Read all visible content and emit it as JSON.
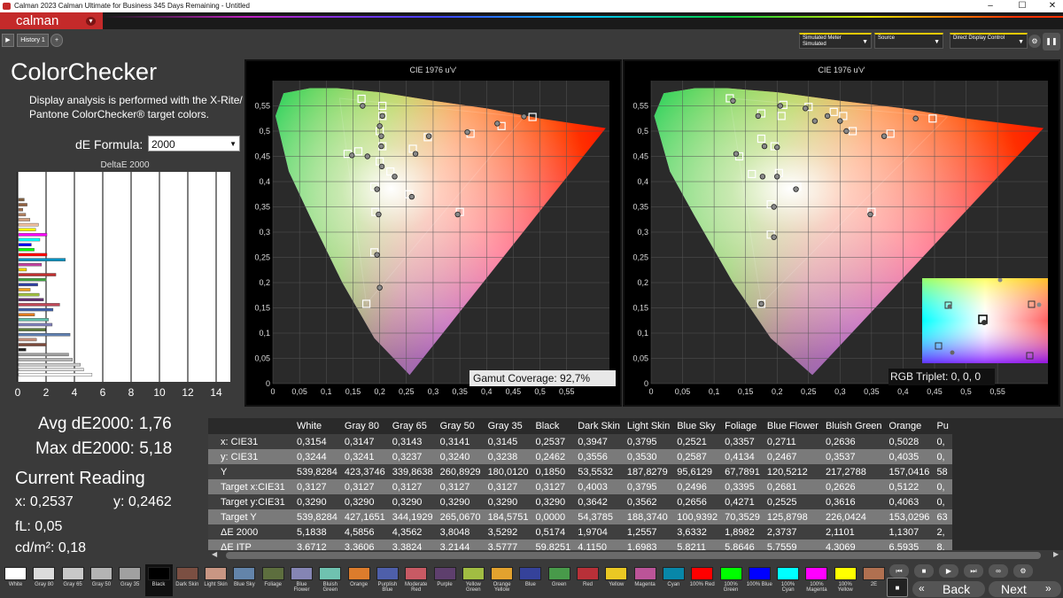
{
  "window": {
    "title": "Calman 2023 Calman Ultimate for Business 345 Days Remaining - Untitled",
    "min": "–",
    "max": "☐",
    "close": "✕"
  },
  "app": {
    "logo": "calman",
    "caret": "▾"
  },
  "tabs": {
    "history": "History 1",
    "add": "+"
  },
  "toolbar": {
    "sim_meter_line1": "Simulated Meter",
    "sim_meter_line2": "Simulated",
    "source": "Source",
    "ddc": "Direct Display Control"
  },
  "left": {
    "title": "ColorChecker",
    "description": "Display analysis is performed with the X-Rite/ Pantone ColorChecker® target colors.",
    "de_formula_label": "dE Formula:",
    "de_formula_value": "2000",
    "chart_title": "DeltaE 2000"
  },
  "stats": {
    "avg": "Avg dE2000: 1,76",
    "max": "Max dE2000: 5,18",
    "current_reading": "Current Reading",
    "x": "x: 0,2537",
    "y": "y: 0,2462",
    "fl": "fL: 0,05",
    "cdm2": "cd/m²: 0,18"
  },
  "plots": {
    "title": "CIE 1976 u'v'",
    "gamut": "Gamut Coverage:  92,7%",
    "rgb": "RGB Triplet: 0, 0, 0"
  },
  "chart_data": [
    {
      "type": "bar",
      "orientation": "horizontal",
      "title": "DeltaE 2000",
      "xlim": [
        0,
        15
      ],
      "xticks": [
        "0",
        "2",
        "4",
        "6",
        "8",
        "10",
        "12",
        "14"
      ],
      "values": [
        5.18,
        4.59,
        4.36,
        3.8,
        3.53,
        0.52,
        1.97,
        1.26,
        3.63,
        1.9,
        2.37,
        2.11,
        1.13,
        2.43,
        2.9,
        1.76,
        1.45,
        0.82,
        1.35,
        1.95,
        2.63,
        0.56,
        1.62,
        3.3,
        2.0,
        1.1,
        0.9,
        1.5,
        2.0,
        1.2,
        1.4,
        0.8,
        0.5,
        0.3,
        0.6,
        0.4
      ],
      "colors": [
        "#ffffff",
        "#e0e0e0",
        "#cccccc",
        "#b5b5b5",
        "#9d9d9d",
        "#222222",
        "#7b4a3c",
        "#c48f7b",
        "#5f7fb0",
        "#5b7a3c",
        "#8080b9",
        "#5fc0ab",
        "#e07a20",
        "#4060a8",
        "#c04858",
        "#603070",
        "#a0c040",
        "#f0a020",
        "#3040a0",
        "#40a040",
        "#c03030",
        "#f0d000",
        "#c040a0",
        "#0090c0",
        "#ff0000",
        "#00ff00",
        "#0000ff",
        "#00ffff",
        "#ff00ff",
        "#ffff00",
        "#f0c0a0",
        "#d0a080",
        "#b08060",
        "#a07050",
        "#906040",
        "#806040"
      ]
    },
    {
      "type": "scatter",
      "title": "CIE 1976 u'v'",
      "xlim": [
        0,
        0.63
      ],
      "ylim": [
        0,
        0.6
      ],
      "xticks": [
        "0",
        "0,05",
        "0,1",
        "0,15",
        "0,2",
        "0,25",
        "0,3",
        "0,35",
        "0,4",
        "0,45",
        "0,5",
        "0,55"
      ],
      "yticks": [
        "0",
        "0,05",
        "0,1",
        "0,15",
        "0,2",
        "0,25",
        "0,3",
        "0,35",
        "0,4",
        "0,45",
        "0,5",
        "0,55"
      ],
      "targets": [
        [
          0.175,
          0.158
        ],
        [
          0.19,
          0.26
        ],
        [
          0.192,
          0.34
        ],
        [
          0.19,
          0.39
        ],
        [
          0.2,
          0.44
        ],
        [
          0.205,
          0.47
        ],
        [
          0.205,
          0.55
        ],
        [
          0.166,
          0.564
        ],
        [
          0.2,
          0.5
        ],
        [
          0.22,
          0.42
        ],
        [
          0.262,
          0.465
        ],
        [
          0.255,
          0.375
        ],
        [
          0.35,
          0.34
        ],
        [
          0.29,
          0.488
        ],
        [
          0.37,
          0.495
        ],
        [
          0.428,
          0.51
        ],
        [
          0.486,
          0.528
        ],
        [
          0.14,
          0.455
        ],
        [
          0.16,
          0.46
        ],
        [
          0.205,
          0.53
        ]
      ],
      "measured": [
        [
          0.2,
          0.19
        ],
        [
          0.195,
          0.255
        ],
        [
          0.198,
          0.335
        ],
        [
          0.195,
          0.385
        ],
        [
          0.204,
          0.43
        ],
        [
          0.203,
          0.47
        ],
        [
          0.205,
          0.53
        ],
        [
          0.168,
          0.55
        ],
        [
          0.203,
          0.49
        ],
        [
          0.228,
          0.41
        ],
        [
          0.267,
          0.455
        ],
        [
          0.26,
          0.37
        ],
        [
          0.346,
          0.335
        ],
        [
          0.292,
          0.49
        ],
        [
          0.364,
          0.498
        ],
        [
          0.42,
          0.515
        ],
        [
          0.47,
          0.529
        ],
        [
          0.148,
          0.452
        ],
        [
          0.177,
          0.45
        ],
        [
          0.2,
          0.51
        ]
      ]
    },
    {
      "type": "scatter",
      "title": "CIE 1976 u'v'",
      "xlim": [
        0,
        0.63
      ],
      "ylim": [
        0,
        0.6
      ],
      "xticks": [
        "0",
        "0,05",
        "0,1",
        "0,15",
        "0,2",
        "0,25",
        "0,3",
        "0,35",
        "0,4",
        "0,45",
        "0,5",
        "0,55"
      ],
      "yticks": [
        "0",
        "0,05",
        "0,1",
        "0,15",
        "0,2",
        "0,25",
        "0,3",
        "0,35",
        "0,4",
        "0,45",
        "0,5",
        "0,55"
      ],
      "targets": [
        [
          0.175,
          0.158
        ],
        [
          0.19,
          0.295
        ],
        [
          0.19,
          0.355
        ],
        [
          0.16,
          0.415
        ],
        [
          0.175,
          0.485
        ],
        [
          0.203,
          0.417
        ],
        [
          0.232,
          0.39
        ],
        [
          0.196,
          0.47
        ],
        [
          0.125,
          0.565
        ],
        [
          0.175,
          0.535
        ],
        [
          0.21,
          0.552
        ],
        [
          0.25,
          0.548
        ],
        [
          0.29,
          0.538
        ],
        [
          0.305,
          0.53
        ],
        [
          0.32,
          0.5
        ],
        [
          0.38,
          0.495
        ],
        [
          0.447,
          0.525
        ],
        [
          0.35,
          0.34
        ],
        [
          0.14,
          0.45
        ],
        [
          0.207,
          0.53
        ]
      ],
      "measured": [
        [
          0.175,
          0.158
        ],
        [
          0.195,
          0.29
        ],
        [
          0.195,
          0.35
        ],
        [
          0.177,
          0.41
        ],
        [
          0.18,
          0.47
        ],
        [
          0.2,
          0.41
        ],
        [
          0.23,
          0.385
        ],
        [
          0.2,
          0.468
        ],
        [
          0.13,
          0.56
        ],
        [
          0.17,
          0.53
        ],
        [
          0.205,
          0.55
        ],
        [
          0.245,
          0.545
        ],
        [
          0.28,
          0.53
        ],
        [
          0.3,
          0.52
        ],
        [
          0.31,
          0.5
        ],
        [
          0.37,
          0.49
        ],
        [
          0.42,
          0.525
        ],
        [
          0.348,
          0.335
        ],
        [
          0.135,
          0.455
        ],
        [
          0.26,
          0.52
        ]
      ]
    }
  ],
  "table": {
    "headers": [
      "",
      "White",
      "Gray 80",
      "Gray 65",
      "Gray 50",
      "Gray 35",
      "Black",
      "Dark Skin",
      "Light Skin",
      "Blue Sky",
      "Foliage",
      "Blue Flower",
      "Bluish Green",
      "Orange",
      "Pu"
    ],
    "rows": [
      [
        "x: CIE31",
        "0,3154",
        "0,3147",
        "0,3143",
        "0,3141",
        "0,3145",
        "0,2537",
        "0,3947",
        "0,3795",
        "0,2521",
        "0,3357",
        "0,2711",
        "0,2636",
        "0,5028",
        "0,"
      ],
      [
        "y: CIE31",
        "0,3244",
        "0,3241",
        "0,3237",
        "0,3240",
        "0,3238",
        "0,2462",
        "0,3556",
        "0,3530",
        "0,2587",
        "0,4134",
        "0,2467",
        "0,3537",
        "0,4035",
        "0,"
      ],
      [
        "Y",
        "539,8284",
        "423,3746",
        "339,8638",
        "260,8929",
        "180,0120",
        "0,1850",
        "53,5532",
        "187,8279",
        "95,6129",
        "67,7891",
        "120,5212",
        "217,2788",
        "157,0416",
        "58"
      ],
      [
        "Target x:CIE31",
        "0,3127",
        "0,3127",
        "0,3127",
        "0,3127",
        "0,3127",
        "0,3127",
        "0,4003",
        "0,3795",
        "0,2496",
        "0,3395",
        "0,2681",
        "0,2626",
        "0,5122",
        "0,"
      ],
      [
        "Target y:CIE31",
        "0,3290",
        "0,3290",
        "0,3290",
        "0,3290",
        "0,3290",
        "0,3290",
        "0,3642",
        "0,3562",
        "0,2656",
        "0,4271",
        "0,2525",
        "0,3616",
        "0,4063",
        "0,"
      ],
      [
        "Target Y",
        "539,8284",
        "427,1651",
        "344,1929",
        "265,0670",
        "184,5751",
        "0,0000",
        "54,3785",
        "188,3740",
        "100,9392",
        "70,3529",
        "125,8798",
        "226,0424",
        "153,0296",
        "63"
      ],
      [
        "ΔE 2000",
        "5,1838",
        "4,5856",
        "4,3562",
        "3,8048",
        "3,5292",
        "0,5174",
        "1,9704",
        "1,2557",
        "3,6332",
        "1,8982",
        "2,3737",
        "2,1101",
        "1,1307",
        "2,"
      ],
      [
        "ΔE ITP",
        "3,6712",
        "3,3606",
        "3,3824",
        "3,2144",
        "3,5777",
        "59,8251",
        "4,1150",
        "1,6983",
        "5,8211",
        "5,8646",
        "5,7559",
        "4,3069",
        "6,5935",
        "8,"
      ]
    ]
  },
  "swatches": [
    {
      "label": "White",
      "color": "#ffffff"
    },
    {
      "label": "Gray 80",
      "color": "#dcdcdc"
    },
    {
      "label": "Gray 65",
      "color": "#c8c8c8"
    },
    {
      "label": "Gray 50",
      "color": "#b4b4b4"
    },
    {
      "label": "Gray 35",
      "color": "#a0a0a0"
    },
    {
      "label": "Black",
      "color": "#000000"
    },
    {
      "label": "Dark Skin",
      "color": "#7b4f42"
    },
    {
      "label": "Light Skin",
      "color": "#c99683"
    },
    {
      "label": "Blue Sky",
      "color": "#6384aa"
    },
    {
      "label": "Foliage",
      "color": "#5d6e3e"
    },
    {
      "label": "Blue Flower",
      "color": "#8585b4"
    },
    {
      "label": "Bluish Green",
      "color": "#6fc2b0"
    },
    {
      "label": "Orange",
      "color": "#dc7c2c"
    },
    {
      "label": "Purplish Blue",
      "color": "#4e5faa"
    },
    {
      "label": "Moderate Red",
      "color": "#c85a64"
    },
    {
      "label": "Purple",
      "color": "#5e3f6d"
    },
    {
      "label": "Yellow Green",
      "color": "#a1bd42"
    },
    {
      "label": "Orange Yellow",
      "color": "#e3a22e"
    },
    {
      "label": "Blue",
      "color": "#35429a"
    },
    {
      "label": "Green",
      "color": "#489a4a"
    },
    {
      "label": "Red",
      "color": "#b83038"
    },
    {
      "label": "Yellow",
      "color": "#eac823"
    },
    {
      "label": "Magenta",
      "color": "#bb5498"
    },
    {
      "label": "Cyan",
      "color": "#0887a9"
    },
    {
      "label": "100% Red",
      "color": "#ff0000"
    },
    {
      "label": "100% Green",
      "color": "#00ff00"
    },
    {
      "label": "100% Blue",
      "color": "#0000ff"
    },
    {
      "label": "100% Cyan",
      "color": "#00ffff"
    },
    {
      "label": "100% Magenta",
      "color": "#ff00ff"
    },
    {
      "label": "100% Yellow",
      "color": "#ffff00"
    },
    {
      "label": "2E",
      "color": "#b07050"
    }
  ],
  "nav": {
    "back": "Back",
    "next": "Next"
  }
}
